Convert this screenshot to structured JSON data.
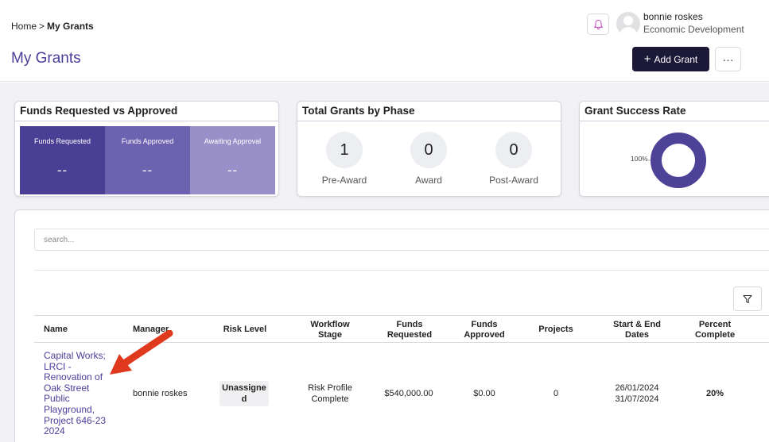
{
  "breadcrumb": {
    "home": "Home",
    "separator": ">",
    "current": "My Grants"
  },
  "page_title": "My Grants",
  "user": {
    "name": "bonnie roskes",
    "org": "Economic Development"
  },
  "actions": {
    "add_grant": "Add Grant",
    "more": "···"
  },
  "icons": {
    "bell": "bell-icon",
    "plus": "plus-icon",
    "filter": "filter-icon",
    "more": "more-horizontal-icon"
  },
  "colors": {
    "accent": "#4a3f9b",
    "dark_button": "#1b1838",
    "funds_requested": "#4a3f94",
    "funds_approved": "#6d62b0",
    "awaiting_approval": "#9a90c9",
    "donut": "#4d4298",
    "arrow": "#e03a1e"
  },
  "funds_card": {
    "title": "Funds Requested vs Approved",
    "cells": [
      {
        "label": "Funds Requested",
        "value": "--"
      },
      {
        "label": "Funds Approved",
        "value": "--"
      },
      {
        "label": "Awaiting Approval",
        "value": "--"
      }
    ]
  },
  "phase_card": {
    "title": "Total Grants by Phase",
    "phases": [
      {
        "label": "Pre-Award",
        "count": "1"
      },
      {
        "label": "Award",
        "count": "0"
      },
      {
        "label": "Post-Award",
        "count": "0"
      }
    ]
  },
  "success_card": {
    "title": "Grant Success Rate",
    "label": "100%",
    "value": 1.0
  },
  "search": {
    "placeholder": "search..."
  },
  "table": {
    "columns": [
      "Name",
      "Manager",
      "Risk Level",
      "Workflow Stage",
      "Funds Requested",
      "Funds Approved",
      "Projects",
      "Start & End Dates",
      "Percent Complete"
    ],
    "rows": [
      {
        "name": "Capital Works; LRCI - Renovation of Oak Street Public Playground, Project 646-23 2024",
        "manager": "bonnie roskes",
        "risk_level": "Unassigned",
        "workflow_stage": "Risk Profile Complete",
        "funds_requested": "$540,000.00",
        "funds_approved": "$0.00",
        "projects": "0",
        "start_date": "26/01/2024",
        "end_date": "31/07/2024",
        "percent_complete": "20%"
      }
    ]
  }
}
